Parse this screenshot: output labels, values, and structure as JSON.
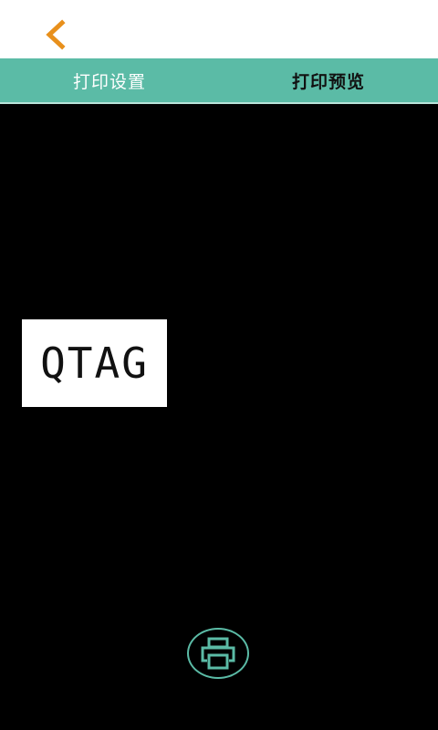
{
  "tabs": {
    "settings_label": "打印设置",
    "preview_label": "打印预览"
  },
  "preview": {
    "label_text": "QTAG"
  },
  "icons": {
    "back": "chevron-left-icon",
    "print": "printer-icon"
  },
  "colors": {
    "accent": "#5bbba6",
    "back_arrow": "#e8901c",
    "background": "#000000",
    "top_bar": "#ffffff"
  }
}
